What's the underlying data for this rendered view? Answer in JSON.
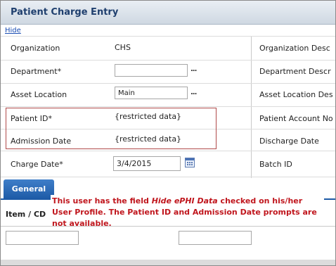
{
  "header": {
    "title": "Patient Charge Entry",
    "hide_link": "Hide"
  },
  "form": {
    "organization": {
      "label": "Organization",
      "value": "CHS"
    },
    "organization_desc": {
      "label": "Organization Desc"
    },
    "department": {
      "label": "Department*",
      "value": ""
    },
    "department_desc": {
      "label": "Department Descr"
    },
    "asset_location": {
      "label": "Asset Location",
      "value": "Main"
    },
    "asset_location_desc": {
      "label": "Asset Location Des"
    },
    "patient_id": {
      "label": "Patient ID*",
      "value": "{restricted data}"
    },
    "patient_account": {
      "label": "Patient Account No"
    },
    "admission_date": {
      "label": "Admission Date",
      "value": "{restricted data}"
    },
    "discharge_date": {
      "label": "Discharge Date"
    },
    "charge_date": {
      "label": "Charge Date*",
      "value": "3/4/2015"
    },
    "batch_id": {
      "label": "Batch ID"
    },
    "lookup_glyph": "...",
    "calendar_icon": "calendar-icon"
  },
  "tabs": {
    "general": "General"
  },
  "note": {
    "prefix": "This user has the field ",
    "field": "Hide ePHI Data",
    "suffix": " checked on his/her User Profile. The Patient ID and Admission Date prompts are not available."
  },
  "grid": {
    "item_header": "Item / CD"
  },
  "colors": {
    "title": "#1f3f6e",
    "tab": "#1d5aa6",
    "note": "#c0161d",
    "highlight_border": "#b04a4a"
  }
}
